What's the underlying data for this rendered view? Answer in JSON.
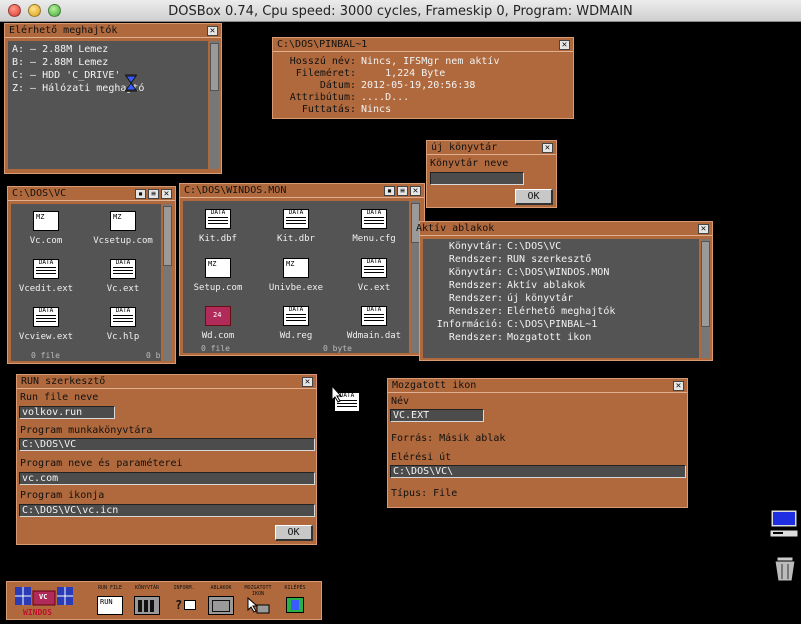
{
  "mac_title": "DOSBox 0.74, Cpu speed:    3000 cycles, Frameskip  0, Program:   WDMAIN",
  "drives": {
    "title": "Elérhető meghajtók",
    "items": [
      "A: – 2.88M Lemez",
      "B: – 2.88M Lemez",
      "C: – HDD 'C_DRIVE'",
      "Z: – Hálózati meghajtó"
    ]
  },
  "fileinfo": {
    "title": "C:\\DOS\\PINBAL~1",
    "rows": [
      {
        "label": "Hosszú név:",
        "value": "Nincs, IFSMgr nem aktív"
      },
      {
        "label": "Fileméret:",
        "value": "    1,224 Byte"
      },
      {
        "label": "Dátum:",
        "value": "2012-05-19,20:56:38"
      },
      {
        "label": "Attribútum:",
        "value": "....D..."
      },
      {
        "label": "Futtatás:",
        "value": "Nincs"
      }
    ]
  },
  "newdir": {
    "title": "új könyvtár",
    "label": "Könyvtár neve",
    "value": "",
    "ok": "OK"
  },
  "vc_window": {
    "title": "C:\\DOS\\VC",
    "files": [
      {
        "name": "Vc.com",
        "type": "mz"
      },
      {
        "name": "Vcsetup.com",
        "type": "mz"
      },
      {
        "name": "Vcedit.ext",
        "type": "data"
      },
      {
        "name": "Vc.ext",
        "type": "data"
      },
      {
        "name": "Vcview.ext",
        "type": "data"
      },
      {
        "name": "Vc.hlp",
        "type": "data"
      }
    ],
    "footer_left": "0 file",
    "footer_right": "0 b"
  },
  "windos_window": {
    "title": "C:\\DOS\\WINDOS.MON",
    "files": [
      {
        "name": "Kit.dbf",
        "type": "data"
      },
      {
        "name": "Kit.dbr",
        "type": "data"
      },
      {
        "name": "Menu.cfg",
        "type": "data"
      },
      {
        "name": "Setup.com",
        "type": "mz"
      },
      {
        "name": "Univbe.exe",
        "type": "mz"
      },
      {
        "name": "Vc.ext",
        "type": "data"
      },
      {
        "name": "Wd.com",
        "type": "wd"
      },
      {
        "name": "Wd.reg",
        "type": "data"
      },
      {
        "name": "Wdmain.dat",
        "type": "data"
      }
    ],
    "footer_left": "0 file",
    "footer_right": "0 byte"
  },
  "active": {
    "title": "Aktív ablakok",
    "rows": [
      {
        "label": "Könyvtár:",
        "value": "C:\\DOS\\VC"
      },
      {
        "label": "Rendszer:",
        "value": "RUN szerkesztő"
      },
      {
        "label": "Könyvtár:",
        "value": "C:\\DOS\\WINDOS.MON"
      },
      {
        "label": "Rendszer:",
        "value": "Aktív ablakok"
      },
      {
        "label": "Rendszer:",
        "value": "új könyvtár"
      },
      {
        "label": "Rendszer:",
        "value": "Elérhető meghajtók"
      },
      {
        "label": "Információ:",
        "value": "C:\\DOS\\PINBAL~1"
      },
      {
        "label": "Rendszer:",
        "value": "Mozgatott ikon"
      }
    ]
  },
  "run": {
    "title": "RUN szerkesztő",
    "file_label": "Run file neve",
    "file_value": "volkov.run",
    "dir_label": "Program munkakönyvtára",
    "dir_value": "C:\\DOS\\VC",
    "prog_label": "Program neve és paraméterei",
    "prog_value": "vc.com",
    "icon_label": "Program ikonja",
    "icon_value": "C:\\DOS\\VC\\vc.icn",
    "ok": "OK"
  },
  "moved": {
    "title": "Mozgatott ikon",
    "name_label": "Név",
    "name_value": "VC.EXT",
    "source_label": "Forrás: Másik ablak",
    "path_label": "Elérési út",
    "path_value": "C:\\DOS\\VC\\",
    "type_label": "Típus: File"
  },
  "taskbar": {
    "logo": "WINDOS",
    "logo_badge": "VC",
    "buttons": [
      {
        "label": "RUN FILE",
        "inner": "RUN"
      },
      {
        "label": "KÖNYVTÁR",
        "inner": ""
      },
      {
        "label": "INFORM.",
        "inner": "?"
      },
      {
        "label": "ABLAKOK",
        "inner": ""
      },
      {
        "label": "MOZGATOTT\nIKON",
        "inner": ""
      },
      {
        "label": "KILÉPÉS",
        "inner": ""
      }
    ]
  },
  "icons": {
    "data_header": "DATA",
    "mz_header": "MZ",
    "wd_header": "24"
  }
}
